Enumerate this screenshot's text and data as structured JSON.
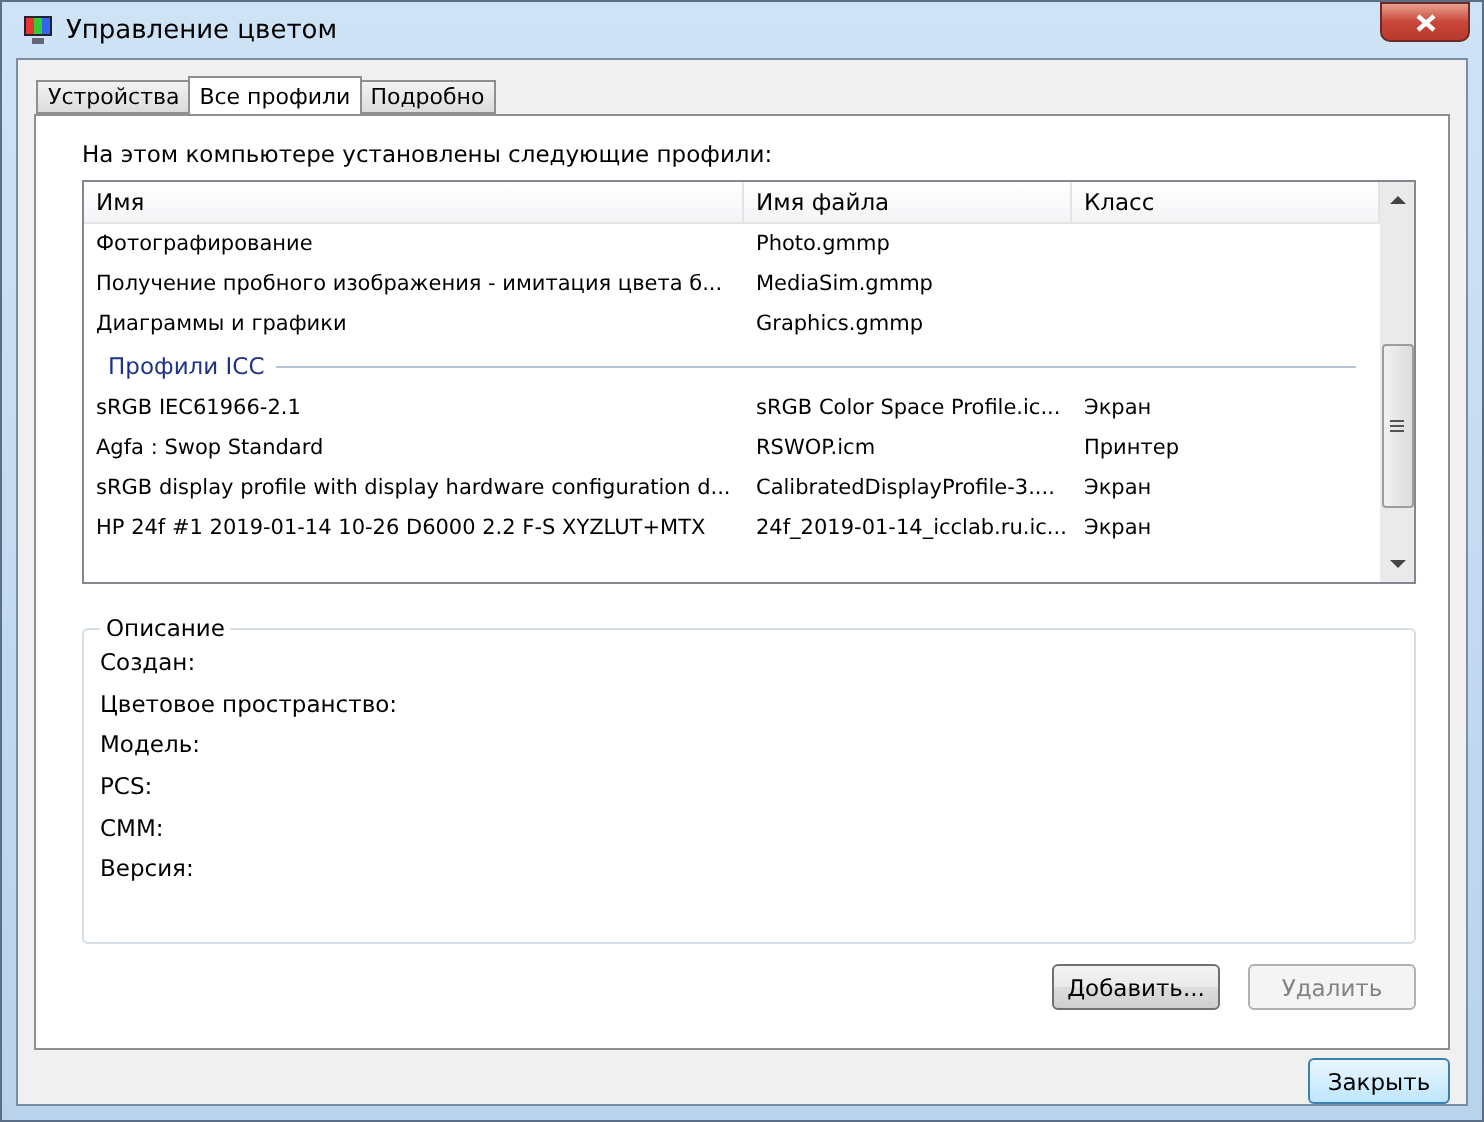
{
  "window": {
    "title": "Управление цветом"
  },
  "tabs": [
    {
      "label": "Устройства",
      "selected": false
    },
    {
      "label": "Все профили",
      "selected": true
    },
    {
      "label": "Подробно",
      "selected": false
    }
  ],
  "intro": "На этом компьютере установлены следующие профили:",
  "table": {
    "columns": [
      "Имя",
      "Имя файла",
      "Класс"
    ],
    "rows": [
      {
        "kind": "row",
        "cells": [
          "Фотографирование",
          "Photo.gmmp"
        ]
      },
      {
        "kind": "row",
        "cells": [
          "Получение пробного изображения - имитация цвета б...",
          "MediaSim.gmmp"
        ]
      },
      {
        "kind": "row",
        "cells": [
          "Диаграммы и графики",
          "Graphics.gmmp"
        ]
      },
      {
        "kind": "group",
        "cells": [
          "Профили ICC"
        ]
      },
      {
        "kind": "row",
        "cells": [
          "sRGB IEC61966-2.1",
          "sRGB Color Space Profile.ic...",
          "Экран"
        ]
      },
      {
        "kind": "row",
        "cells": [
          "Agfa : Swop Standard",
          "RSWOP.icm",
          "Принтер"
        ]
      },
      {
        "kind": "row",
        "cells": [
          "sRGB display profile with display hardware configuration d...",
          "CalibratedDisplayProfile-3....",
          "Экран"
        ]
      },
      {
        "kind": "row",
        "cells": [
          "HP 24f #1 2019-01-14 10-26 D6000 2.2 F-S XYZLUT+MTX",
          "24f_2019-01-14_icclab.ru.ic...",
          "Экран"
        ]
      }
    ]
  },
  "description": {
    "title": "Описание",
    "fields": [
      "Создан:",
      "Цветовое пространство:",
      "Модель:",
      "PCS:",
      "CMM:",
      "Версия:"
    ]
  },
  "buttons": [
    {
      "label": "Добавить...",
      "disabled": false
    },
    {
      "label": "Удалить",
      "disabled": true
    }
  ],
  "close_button": {
    "label": "Закрыть"
  }
}
